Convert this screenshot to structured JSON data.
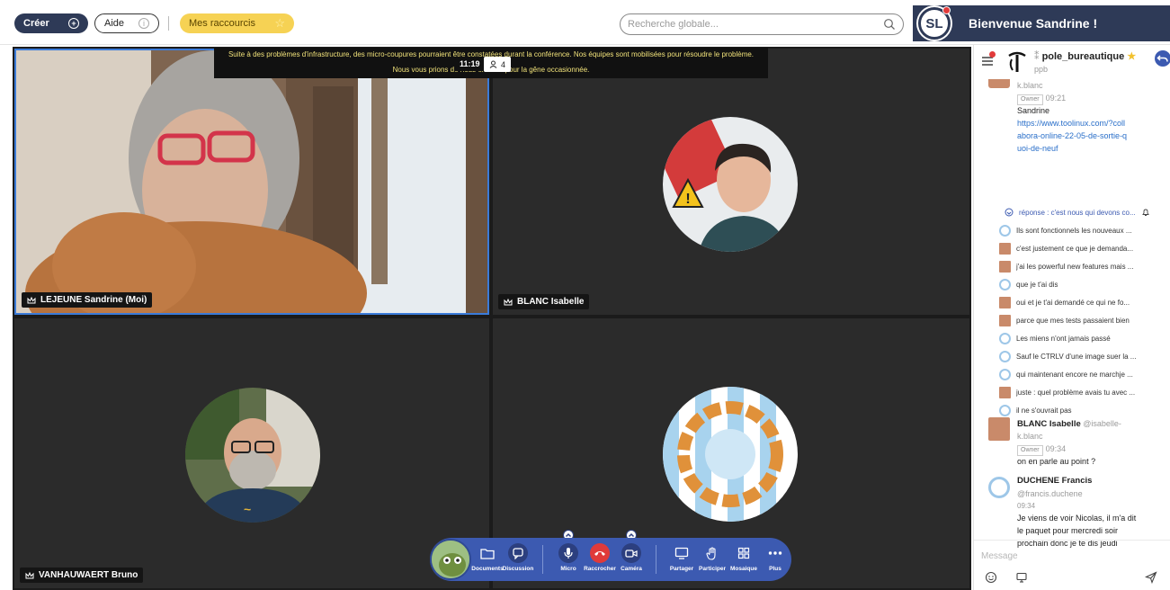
{
  "topbar": {
    "create_label": "Créer",
    "help_label": "Aide",
    "shortcuts_label": "Mes raccourcis",
    "search_placeholder": "Recherche globale...",
    "avatar_initials": "SL",
    "welcome": "Bienvenue Sandrine !"
  },
  "conference": {
    "banner_line1": "Suite à des problèmes d'infrastructure, des micro-coupures pourraient être constatées durant la conférence. Nos équipes sont mobilisées pour résoudre le problème.",
    "banner_line2": "Nous vous prions de nous excuser pour la gêne occasionnée.",
    "timer": "11:19",
    "participant_count": "4",
    "participants": [
      {
        "name": "LEJEUNE Sandrine (Moi)"
      },
      {
        "name": "BLANC Isabelle"
      },
      {
        "name": "VANHAUWAERT Bruno"
      },
      {
        "name": ""
      }
    ]
  },
  "controls": {
    "documents": "Documents",
    "discussion": "Discussion",
    "micro": "Micro",
    "raccrocher": "Raccrocher",
    "camera": "Caméra",
    "partager": "Partager",
    "participer": "Participer",
    "mosaique": "Mosaique",
    "plus": "Plus"
  },
  "chat": {
    "room_name": "pole_bureautique",
    "room_sub": "ppb",
    "first_msg": {
      "handle_tail": "k.blanc",
      "badge": "Owner",
      "time": "09:21",
      "text": "Sandrine",
      "link": "https://www.toolinux.com/?collabora-online-22-05-de-sortie-quoi-de-neuf"
    },
    "reply_label": "réponse : c'est nous qui devons co...",
    "thread": [
      {
        "avatar": "fr",
        "text": "Ils sont fonctionnels les nouveaux ..."
      },
      {
        "avatar": "sq",
        "text": "c'est justement ce que je demanda..."
      },
      {
        "avatar": "sq",
        "text": "j'ai les powerful new features mais ..."
      },
      {
        "avatar": "fr",
        "text": "que je t'ai dis"
      },
      {
        "avatar": "sq",
        "text": "oui et je t'ai demandé ce qui ne fo..."
      },
      {
        "avatar": "sq",
        "text": "parce que mes tests passaient bien"
      },
      {
        "avatar": "fr",
        "text": "Les miens n'ont jamais passé"
      },
      {
        "avatar": "fr",
        "text": "Sauf le CTRLV d'une image suer la ..."
      },
      {
        "avatar": "fr",
        "text": "qui maintenant encore ne marchje ..."
      },
      {
        "avatar": "sq",
        "text": "juste : quel problème avais tu avec ..."
      },
      {
        "avatar": "fr",
        "text": "il ne s'ouvrait pas"
      }
    ],
    "msg_blanc": {
      "sender": "BLANC Isabelle",
      "handle": "@isabelle-",
      "handle2": "k.blanc",
      "badge": "Owner",
      "time": "09:34",
      "text": "on en parle au point ?"
    },
    "msg_duchene": {
      "sender": "DUCHENE Francis",
      "handle": "@francis.duchene",
      "time": "09:34",
      "text": "Je viens de voir Nicolas, il m'a dit le paquet pour mercredi soir prochain donc je te dis jeudi"
    },
    "composer_placeholder": "Message"
  },
  "colors": {
    "navy": "#2e3a57",
    "accent_blue": "#3c5ab1",
    "shortcut_yellow": "#f6d254",
    "hangup_red": "#e03a3a"
  }
}
